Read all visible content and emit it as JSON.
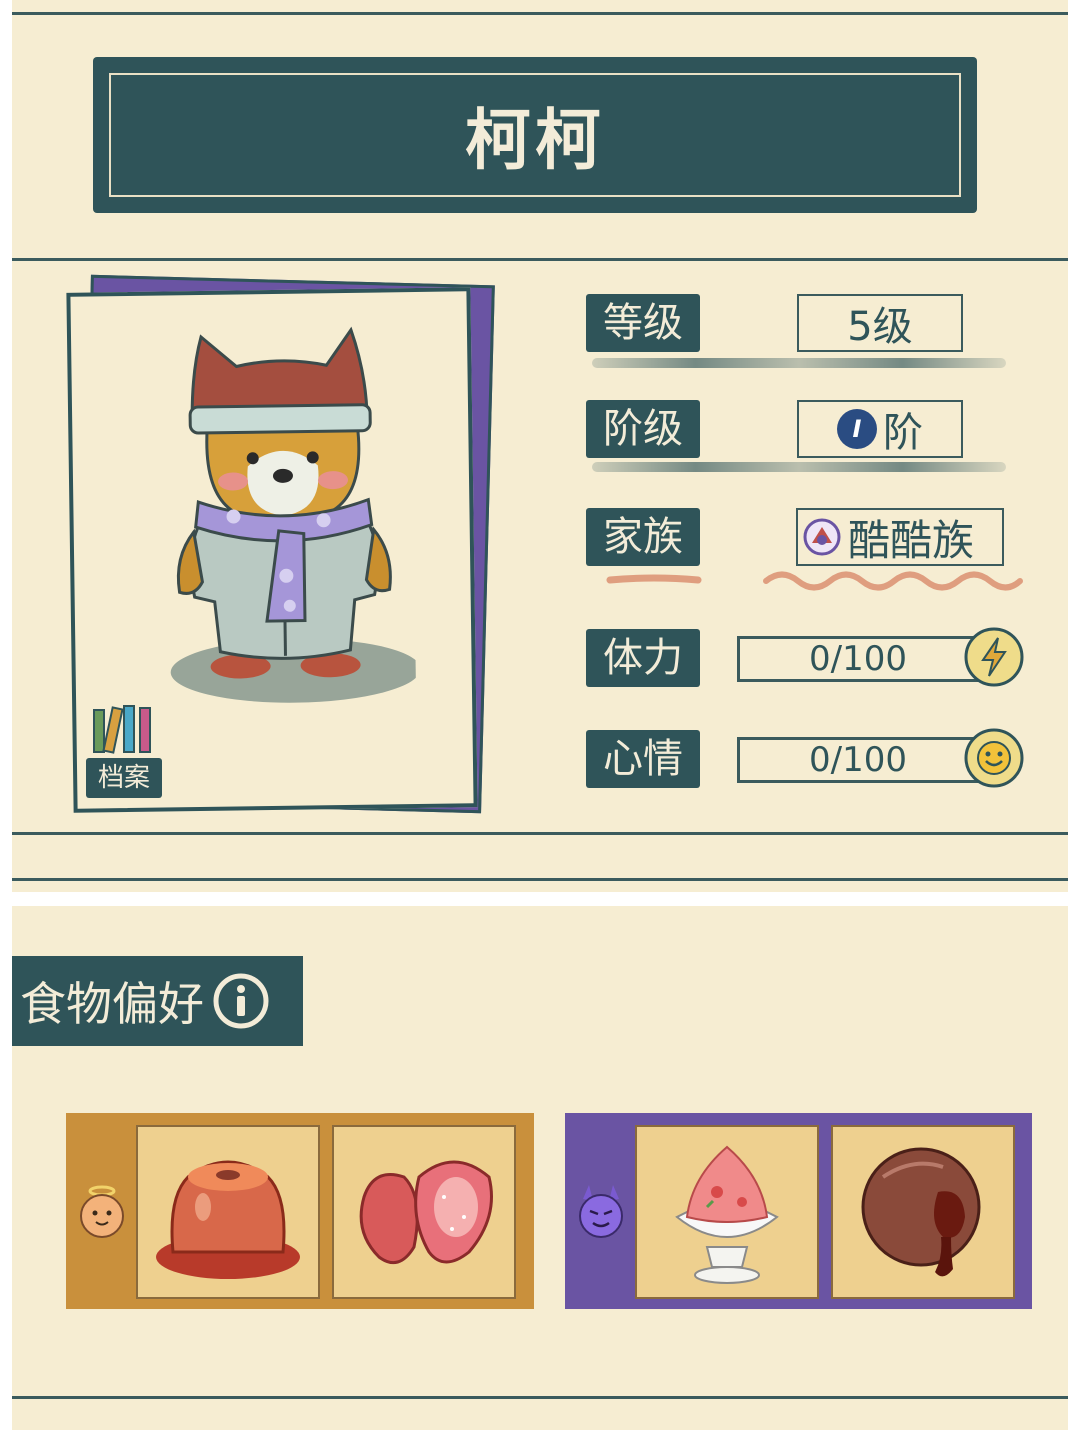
{
  "character": {
    "name": "柯柯"
  },
  "archive": {
    "label": "档案"
  },
  "stats": {
    "level": {
      "label": "等级",
      "value": "5级"
    },
    "rank": {
      "label": "阶级",
      "badge": "I",
      "value": "阶"
    },
    "family": {
      "label": "家族",
      "value": "酷酷族",
      "icon": "family-emblem-icon"
    },
    "stamina": {
      "label": "体力",
      "value": "0/100",
      "fraction": 0.0,
      "icon": "lightning-icon"
    },
    "mood": {
      "label": "心情",
      "value": "0/100",
      "fraction": 0.0,
      "icon": "smiley-icon"
    }
  },
  "food": {
    "title": "食物偏好",
    "liked": {
      "icon": "angel-face-icon",
      "items": [
        "pudding-icon",
        "strawberry-icon"
      ]
    },
    "disliked": {
      "icon": "devil-face-icon",
      "items": [
        "shaved-ice-icon",
        "chocolate-lava-cake-icon"
      ]
    }
  },
  "colors": {
    "primary": "#2f5459",
    "background": "#f6edd2",
    "liked_panel": "#c9903c",
    "disliked_panel": "#6a54a3",
    "slot": "#eed08f"
  }
}
